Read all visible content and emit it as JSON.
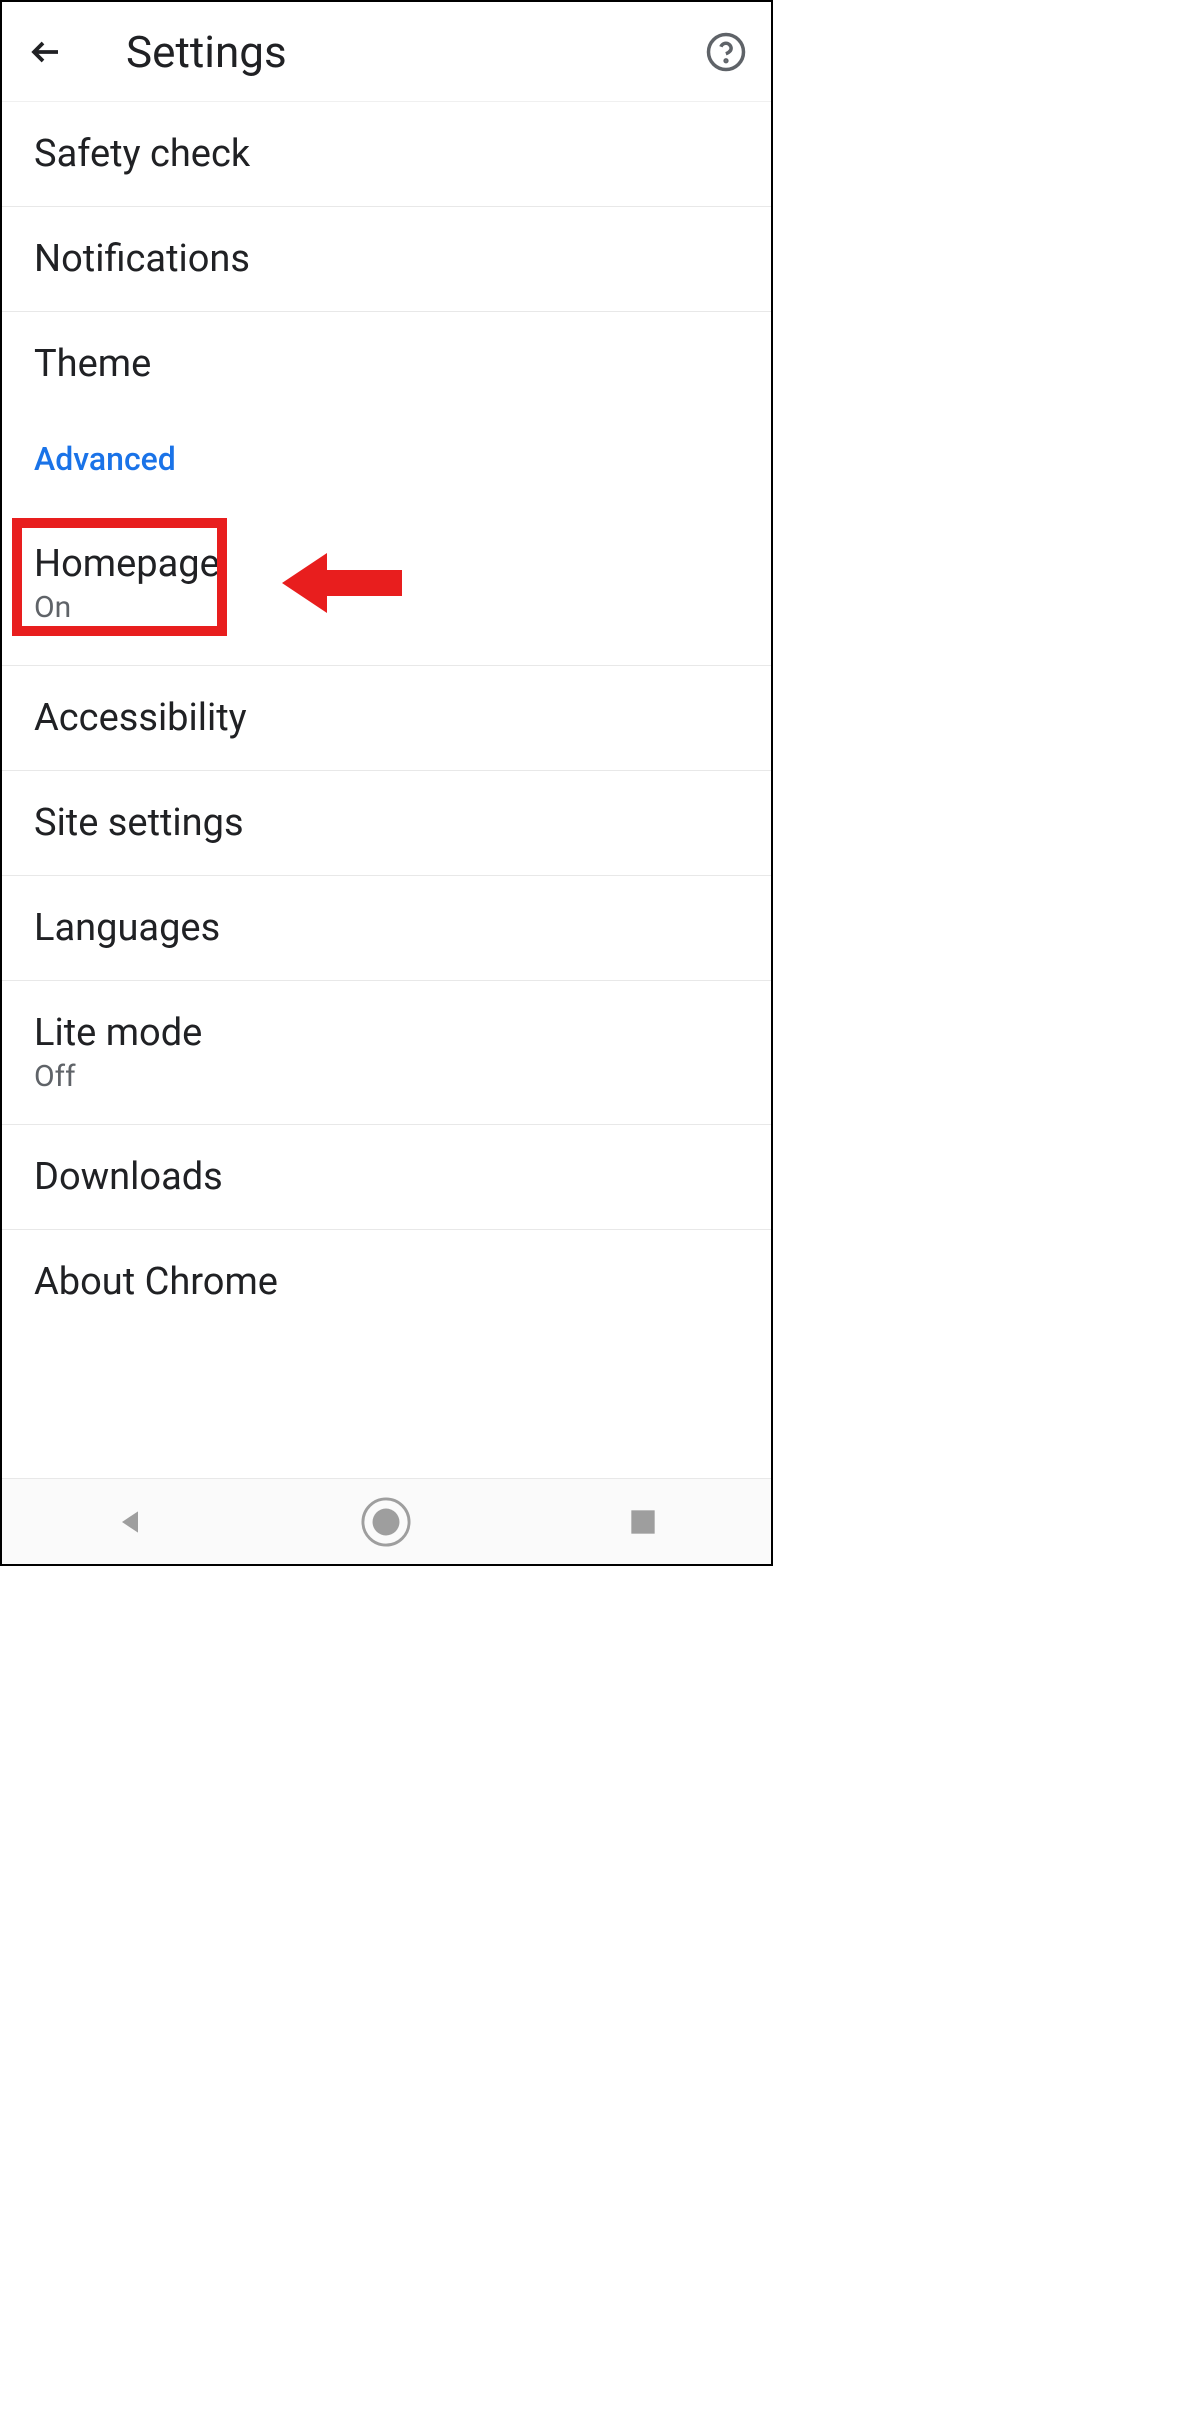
{
  "header": {
    "title": "Settings"
  },
  "section_header": "Advanced",
  "items": {
    "safety_check": {
      "label": "Safety check"
    },
    "notifications": {
      "label": "Notifications"
    },
    "theme": {
      "label": "Theme"
    },
    "homepage": {
      "label": "Homepage",
      "sublabel": "On"
    },
    "accessibility": {
      "label": "Accessibility"
    },
    "site_settings": {
      "label": "Site settings"
    },
    "languages": {
      "label": "Languages"
    },
    "lite_mode": {
      "label": "Lite mode",
      "sublabel": "Off"
    },
    "downloads": {
      "label": "Downloads"
    },
    "about_chrome": {
      "label": "About Chrome"
    }
  },
  "annotation": {
    "highlight_color": "#e81e1e",
    "highlighted_item": "homepage"
  }
}
